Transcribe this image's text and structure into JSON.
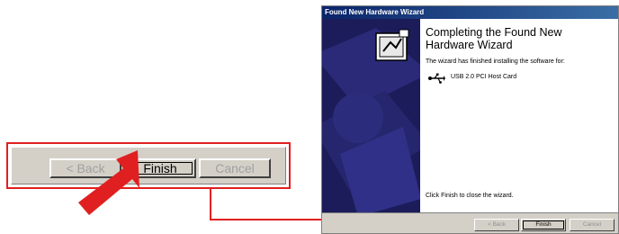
{
  "zoomed_buttons": {
    "back_label": "< Back",
    "finish_label": "Finish",
    "cancel_label": "Cancel"
  },
  "wizard": {
    "title": "Found New Hardware Wizard",
    "heading_line1": "Completing the Found New",
    "heading_line2": "Hardware Wizard",
    "description": "The wizard has finished installing the software for:",
    "device_name": "USB 2.0 PCI Host Card",
    "close_hint": "Click Finish to close the wizard.",
    "buttons": {
      "back_label": "< Back",
      "finish_label": "Finish",
      "cancel_label": "Cancel"
    }
  },
  "colors": {
    "highlight_red": "#e02020",
    "titlebar_blue": "#0a246a",
    "side_panel": "#202060",
    "dialog_gray": "#d4d0c8"
  },
  "icons": [
    "red-pointer-arrow",
    "hardware-install-icon",
    "usb-icon"
  ]
}
